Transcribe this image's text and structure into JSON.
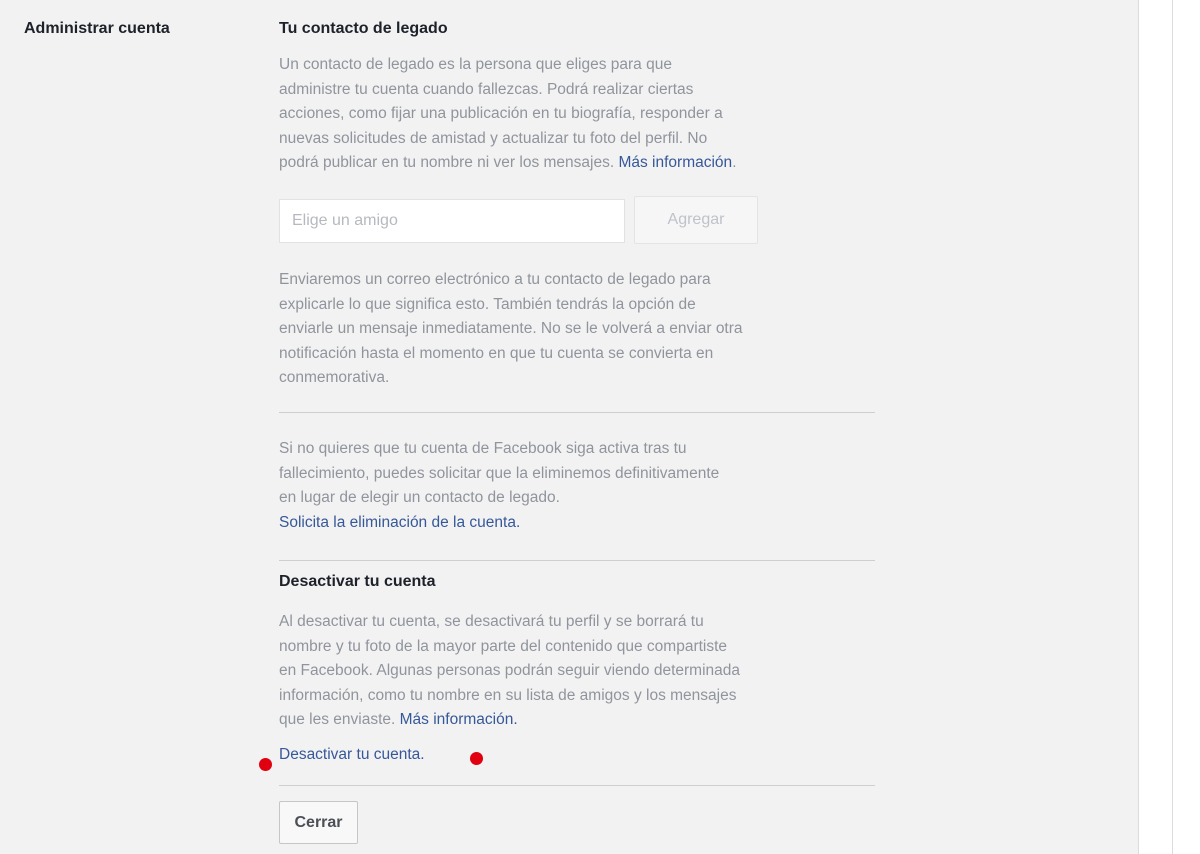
{
  "sidebar": {
    "section_label": "Administrar cuenta"
  },
  "legacy_contact": {
    "title": "Tu contacto de legado",
    "description_lines": [
      "Un contacto de legado es la persona que eliges para que",
      "administre tu cuenta cuando fallezcas. Podrá realizar ciertas",
      "acciones, como fijar una publicación en tu biografía, responder a",
      "nuevas solicitudes de amistad y actualizar tu foto del perfil. No",
      "podrá publicar en tu nombre ni ver los mensajes."
    ],
    "more_info_link": "Más información",
    "friend_input_placeholder": "Elige un amigo",
    "add_button": "Agregar",
    "email_notice_lines": [
      "Enviaremos un correo electrónico a tu contacto de legado para",
      "explicarle lo que significa esto. También tendrás la opción de",
      "enviarle un mensaje inmediatamente. No se le volverá a enviar otra",
      "notificación hasta el momento en que tu cuenta se convierta en",
      "conmemorativa."
    ]
  },
  "deletion": {
    "text_lines": [
      "Si no quieres que tu cuenta de Facebook siga activa tras tu",
      "fallecimiento, puedes solicitar que la eliminemos definitivamente",
      "en lugar de elegir un contacto de legado."
    ],
    "request_link": "Solicita la eliminación de la cuenta."
  },
  "deactivate": {
    "title": "Desactivar tu cuenta",
    "text_lines": [
      "Al desactivar tu cuenta, se desactivará tu perfil y se borrará tu",
      "nombre y tu foto de la mayor parte del contenido que compartiste",
      "en Facebook. Algunas personas podrán seguir viendo determinada",
      "información, como tu nombre en su lista de amigos y los mensajes",
      "que les enviaste."
    ],
    "more_info_link": "Más información.",
    "deactivate_link": "Desactivar tu cuenta.",
    "close_button": "Cerrar"
  },
  "colors": {
    "link": "#365899",
    "muted_text": "#90949c",
    "heading_text": "#1d2129",
    "panel_bg": "#f2f2f2",
    "marker_dot": "#e00010"
  }
}
